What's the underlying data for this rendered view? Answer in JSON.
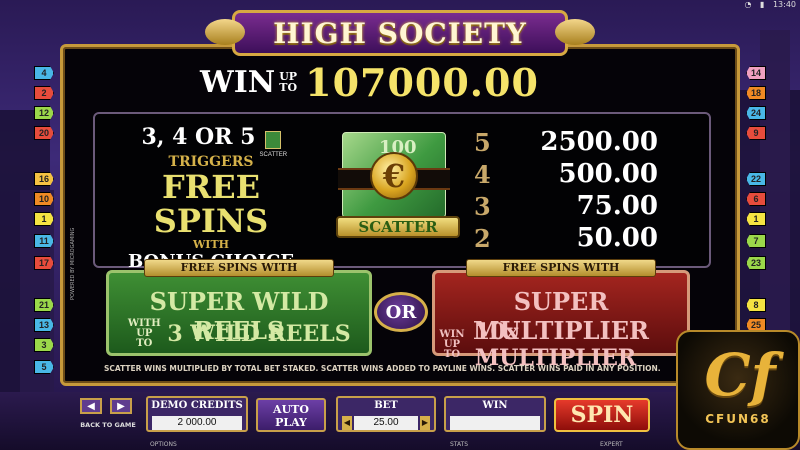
{
  "status_bar": {
    "time": "13:40"
  },
  "header": {
    "title": "HIGH SOCIETY"
  },
  "jackpot": {
    "win_label": "WIN",
    "upto_label": "UP TO",
    "amount": "107000.00"
  },
  "scatter_info": {
    "trigger_count": "3, 4 OR 5",
    "mini_icon_label": "SCATTER",
    "triggers": "TRIGGERS",
    "free_spins": "FREE SPINS",
    "with": "WITH",
    "bonus_choice": "BONUS CHOICE",
    "symbol_bill_text": "100",
    "symbol_coin_glyph": "€",
    "symbol_label": "SCATTER"
  },
  "paytable": [
    {
      "count": "5",
      "value": "2500.00"
    },
    {
      "count": "4",
      "value": "500.00"
    },
    {
      "count": "3",
      "value": "75.00"
    },
    {
      "count": "2",
      "value": "50.00"
    }
  ],
  "features": {
    "left": {
      "header": "FREE SPINS WITH",
      "title": "SUPER WILD REELS",
      "with_text": "WITH UP TO",
      "detail": "3 WILD REELS"
    },
    "or_label": "OR",
    "right": {
      "header": "FREE SPINS WITH",
      "title": "SUPER MULTIPLIER",
      "with_text": "WIN UP TO",
      "detail": "10x MULTIPLIER"
    }
  },
  "note": "SCATTER WINS MULTIPLIED BY TOTAL BET STAKED. SCATTER WINS ADDED TO PAYLINE WINS. SCATTER WINS PAID IN ANY POSITION.",
  "side_note": "POWERED BY MICROGAMING",
  "paylines": {
    "left": [
      "4",
      "2",
      "12",
      "20",
      "16",
      "10",
      "1",
      "11",
      "17",
      "21",
      "13",
      "3",
      "5"
    ],
    "right": [
      "14",
      "18",
      "24",
      "9",
      "22",
      "6",
      "1",
      "7",
      "23",
      "8",
      "25"
    ],
    "colors_left": [
      "#49b7e6",
      "#e74c3c",
      "#9bd84a",
      "#e74c3c",
      "#f5c242",
      "#f08a24",
      "#f5e342",
      "#49b7e6",
      "#e74c3c",
      "#9bd84a",
      "#49b7e6",
      "#9bd84a",
      "#49b7e6"
    ],
    "colors_right": [
      "#f0a0c0",
      "#f08a24",
      "#49b7e6",
      "#e74c3c",
      "#49b7e6",
      "#e74c3c",
      "#f5e342",
      "#9bd84a",
      "#9bd84a",
      "#f5e342",
      "#f08a24"
    ]
  },
  "controls": {
    "back_label": "BACK TO GAME",
    "prev_arrow": "◀",
    "next_arrow": "▶",
    "demo_credits_label": "DEMO CREDITS",
    "demo_credits_value": "2 000.00",
    "autoplay_label": "AUTO PLAY",
    "bet_label": "BET",
    "bet_value": "25.00",
    "bet_dec": "◀",
    "bet_inc": "▶",
    "win_label": "WIN",
    "win_value": "",
    "spin_label": "SPIN"
  },
  "bottom_tabs": {
    "options": "OPTIONS",
    "stats": "STATS",
    "expert": "EXPERT"
  },
  "brand": {
    "mark": "Cf",
    "name": "CFUN68"
  }
}
